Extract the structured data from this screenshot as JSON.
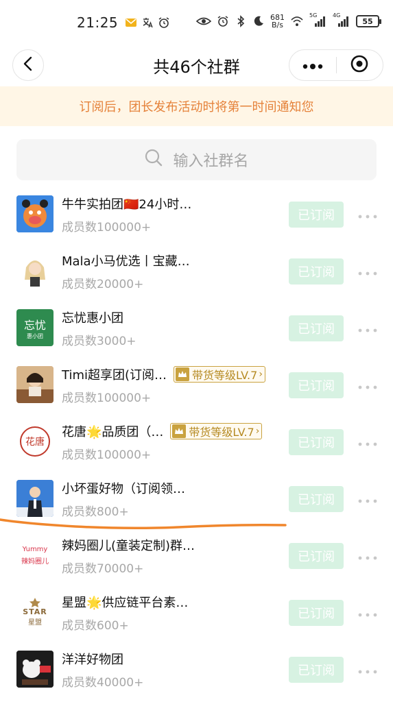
{
  "status": {
    "time": "21:25",
    "net_speed_value": "681",
    "net_speed_unit": "B/s",
    "signal1_label": "5G",
    "signal2_label": "4G",
    "battery": "55"
  },
  "nav": {
    "title": "共46个社群"
  },
  "notice": {
    "text": "订阅后，团长发布活动时将第一时间通知您"
  },
  "search": {
    "placeholder": "输入社群名"
  },
  "groups": [
    {
      "name": "牛牛实拍团🇨🇳24小时…",
      "members": "成员数100000+",
      "button": "已订阅",
      "badge": ""
    },
    {
      "name": "Mala小马优选丨宝藏…",
      "members": "成员数20000+",
      "button": "已订阅",
      "badge": ""
    },
    {
      "name": "忘忧惠小团",
      "members": "成员数3000+",
      "button": "已订阅",
      "badge": "",
      "avatar_text": "忘忧",
      "avatar_sub": "惠小团"
    },
    {
      "name": "Timi超享团(订阅…",
      "members": "成员数100000+",
      "button": "已订阅",
      "badge": "带货等级LV.7"
    },
    {
      "name": "花唐🌟品质团（…",
      "members": "成员数100000+",
      "button": "已订阅",
      "badge": "带货等级LV.7",
      "avatar_text": "花唐"
    },
    {
      "name": "小坏蛋好物（订阅领…",
      "members": "成员数800+",
      "button": "已订阅",
      "badge": ""
    },
    {
      "name": "辣妈圈儿(童装定制)群…",
      "members": "成员数70000+",
      "button": "已订阅",
      "badge": "",
      "avatar_text": "Yummy",
      "avatar_sub": "辣妈圈儿"
    },
    {
      "name": "星盟🌟供应链平台素…",
      "members": "成员数600+",
      "button": "已订阅",
      "badge": "",
      "avatar_text": "STAR",
      "avatar_sub": "星盟"
    },
    {
      "name": "洋洋好物团",
      "members": "成员数40000+",
      "button": "已订阅",
      "badge": ""
    }
  ],
  "colors": {
    "notice_bg": "#fff6e6",
    "notice_text": "#e5823a",
    "subscribed_bg": "#d7f2e2",
    "badge_gold": "#c9a23f",
    "annotation_orange": "#f0862c"
  }
}
